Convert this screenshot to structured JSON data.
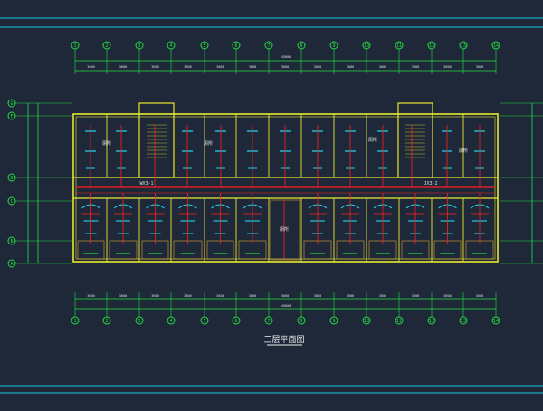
{
  "drawing": {
    "title": "三层平面图",
    "colors": {
      "background": "#1e2838",
      "frame": "#14c8d8",
      "axis": "#22e040",
      "wall": "#e8e830",
      "wall_inner": "#e0a030",
      "pipe": "#ff2020",
      "fixture": "#20d8f0",
      "dim_text": "#e0e0e0",
      "title": "#f0f0f0"
    },
    "axes_columns": [
      "1",
      "2",
      "3",
      "4",
      "5",
      "6",
      "7",
      "8",
      "9",
      "10",
      "11",
      "12",
      "13",
      "14"
    ],
    "axes_rows_left": [
      "G",
      "F",
      "D",
      "C",
      "B",
      "A"
    ],
    "pipe_labels": [
      "WX3-1",
      "JX3-2"
    ],
    "room_labels": [
      "厕所",
      "厕所",
      "厕所",
      "厕所",
      "厕所"
    ],
    "dim_total_label": "45600"
  }
}
